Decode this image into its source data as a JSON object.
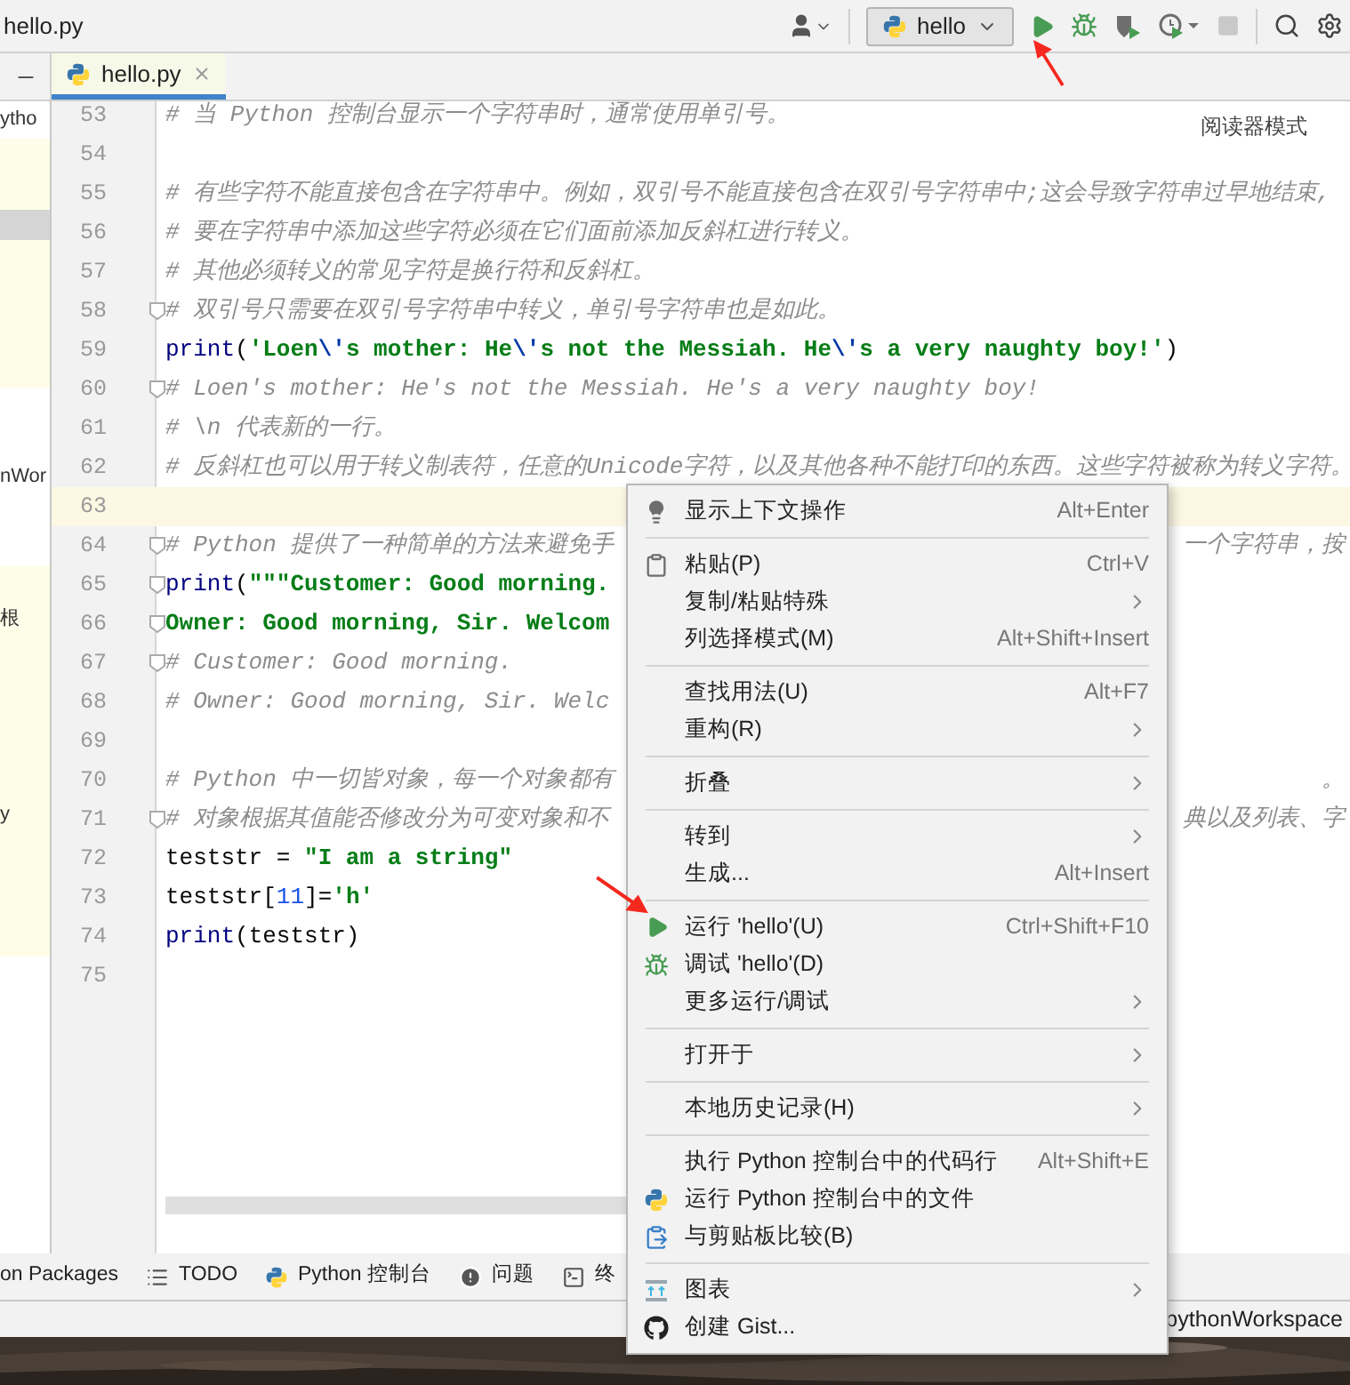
{
  "title_bar": {
    "file": "hello.py"
  },
  "toolbar": {
    "run_config": "hello"
  },
  "project_panel": {
    "items": [
      "ytho",
      "nWor",
      "根",
      "y"
    ]
  },
  "editor_tabs": [
    {
      "label": "hello.py",
      "selected": true
    }
  ],
  "reader_mode": "阅读器模式",
  "code_lines": [
    {
      "number": "53",
      "fold": false,
      "current": false,
      "segments": [
        {
          "kind": "comment",
          "text": "# 当 Python 控制台显示一个字符串时，通常使用单引号。"
        }
      ]
    },
    {
      "number": "54",
      "fold": false,
      "current": false
    },
    {
      "number": "55",
      "fold": false,
      "current": false,
      "segments": [
        {
          "kind": "comment",
          "text": "# 有些字符不能直接包含在字符串中。例如，双引号不能直接包含在双引号字符串中;这会导致字符串过早地结束,"
        }
      ]
    },
    {
      "number": "56",
      "fold": false,
      "current": false,
      "segments": [
        {
          "kind": "comment",
          "text": "# 要在字符串中添加这些字符必须在它们面前添加反斜杠进行转义。"
        }
      ]
    },
    {
      "number": "57",
      "fold": false,
      "current": false,
      "segments": [
        {
          "kind": "comment",
          "text": "# 其他必须转义的常见字符是换行符和反斜杠。"
        }
      ]
    },
    {
      "number": "58",
      "fold": true,
      "current": false,
      "segments": [
        {
          "kind": "comment",
          "text": "# 双引号只需要在双引号字符串中转义，单引号字符串也是如此。"
        }
      ]
    },
    {
      "number": "59",
      "fold": false,
      "current": false,
      "segments": [
        {
          "kind": "builtin",
          "text": "print"
        },
        {
          "kind": "plain",
          "text": "("
        },
        {
          "kind": "string",
          "text": "'Loen"
        },
        {
          "kind": "escape",
          "text": "\\'"
        },
        {
          "kind": "string",
          "text": "s mother: He"
        },
        {
          "kind": "escape",
          "text": "\\'"
        },
        {
          "kind": "string",
          "text": "s not the Messiah. He"
        },
        {
          "kind": "escape",
          "text": "\\'"
        },
        {
          "kind": "string",
          "text": "s a very naughty boy!'"
        },
        {
          "kind": "plain",
          "text": ")"
        }
      ]
    },
    {
      "number": "60",
      "fold": true,
      "current": false,
      "segments": [
        {
          "kind": "comment",
          "text": "# Loen's mother: He's not the Messiah. He's a very naughty boy!"
        }
      ]
    },
    {
      "number": "61",
      "fold": false,
      "current": false,
      "segments": [
        {
          "kind": "comment",
          "text": "# \\n 代表新的一行。"
        }
      ]
    },
    {
      "number": "62",
      "fold": false,
      "current": false,
      "segments": [
        {
          "kind": "comment",
          "text": "# 反斜杠也可以用于转义制表符，任意的Unicode字符，以及其他各种不能打印的东西。这些字符被称为转义字符。"
        }
      ]
    },
    {
      "number": "63",
      "fold": false,
      "current": true
    },
    {
      "number": "64",
      "fold": true,
      "current": false,
      "segments": [
        {
          "kind": "comment",
          "text": "# Python 提供了一种简单的方法来避免手"
        }
      ],
      "tail": "一个字符串，按"
    },
    {
      "number": "65",
      "fold": true,
      "current": false,
      "segments": [
        {
          "kind": "builtin",
          "text": "print"
        },
        {
          "kind": "plain",
          "text": "("
        },
        {
          "kind": "string",
          "text": "\"\"\"Customer: Good morning."
        }
      ]
    },
    {
      "number": "66",
      "fold": true,
      "current": false,
      "segments": [
        {
          "kind": "string",
          "text": "Owner: Good morning, Sir. Welcom"
        }
      ]
    },
    {
      "number": "67",
      "fold": true,
      "current": false,
      "segments": [
        {
          "kind": "comment",
          "text": "# Customer: Good morning."
        }
      ]
    },
    {
      "number": "68",
      "fold": false,
      "current": false,
      "segments": [
        {
          "kind": "comment",
          "text": "# Owner: Good morning, Sir. Welc"
        }
      ]
    },
    {
      "number": "69",
      "fold": false,
      "current": false
    },
    {
      "number": "70",
      "fold": false,
      "current": false,
      "segments": [
        {
          "kind": "comment",
          "text": "# Python 中一切皆对象，每一个对象都有"
        }
      ],
      "tail": "。"
    },
    {
      "number": "71",
      "fold": true,
      "current": false,
      "segments": [
        {
          "kind": "comment",
          "text": "# 对象根据其值能否修改分为可变对象和不"
        }
      ],
      "tail": "典以及列表、字"
    },
    {
      "number": "72",
      "fold": false,
      "current": false,
      "segments": [
        {
          "kind": "plain",
          "text": "teststr = "
        },
        {
          "kind": "string",
          "text": "\"I am a string\""
        }
      ]
    },
    {
      "number": "73",
      "fold": false,
      "current": false,
      "segments": [
        {
          "kind": "plain",
          "text": "teststr["
        },
        {
          "kind": "number",
          "text": "11"
        },
        {
          "kind": "plain",
          "text": "]="
        },
        {
          "kind": "string",
          "text": "'h'"
        }
      ]
    },
    {
      "number": "74",
      "fold": false,
      "current": false,
      "segments": [
        {
          "kind": "builtin",
          "text": "print"
        },
        {
          "kind": "plain",
          "text": "(teststr)"
        }
      ]
    },
    {
      "number": "75",
      "fold": false,
      "current": false
    }
  ],
  "context_menu": {
    "groups": [
      [
        {
          "label": "显示上下文操作",
          "shortcut": "Alt+Enter",
          "submenu": false
        }
      ],
      [
        {
          "label": "粘贴(P)",
          "shortcut": "Ctrl+V",
          "submenu": false
        },
        {
          "label": "复制/粘贴特殊",
          "submenu": true
        },
        {
          "label": "列选择模式(M)",
          "shortcut": "Alt+Shift+Insert",
          "submenu": false
        }
      ],
      [
        {
          "label": "查找用法(U)",
          "shortcut": "Alt+F7",
          "submenu": false
        },
        {
          "label": "重构(R)",
          "submenu": true
        }
      ],
      [
        {
          "label": "折叠",
          "submenu": true
        }
      ],
      [
        {
          "label": "转到",
          "submenu": true
        },
        {
          "label": "生成...",
          "shortcut": "Alt+Insert",
          "submenu": false
        }
      ],
      [
        {
          "label": "运行 'hello'(U)",
          "shortcut": "Ctrl+Shift+F10",
          "submenu": false
        },
        {
          "label": "调试 'hello'(D)",
          "submenu": false
        },
        {
          "label": "更多运行/调试",
          "submenu": true
        }
      ],
      [
        {
          "label": "打开于",
          "submenu": true
        }
      ],
      [
        {
          "label": "本地历史记录(H)",
          "submenu": true
        }
      ],
      [
        {
          "label": "执行 Python 控制台中的代码行",
          "shortcut": "Alt+Shift+E",
          "submenu": false
        },
        {
          "label": "运行 Python 控制台中的文件",
          "submenu": false
        },
        {
          "label": "与剪贴板比较(B)",
          "submenu": false
        }
      ],
      [
        {
          "label": "图表",
          "submenu": true
        },
        {
          "label": "创建 Gist...",
          "submenu": false
        }
      ]
    ]
  },
  "tool_windows": [
    "on Packages",
    "TODO",
    "Python 控制台",
    "问题",
    "终"
  ],
  "status_bar": {
    "path": "pythonWorkspace"
  }
}
